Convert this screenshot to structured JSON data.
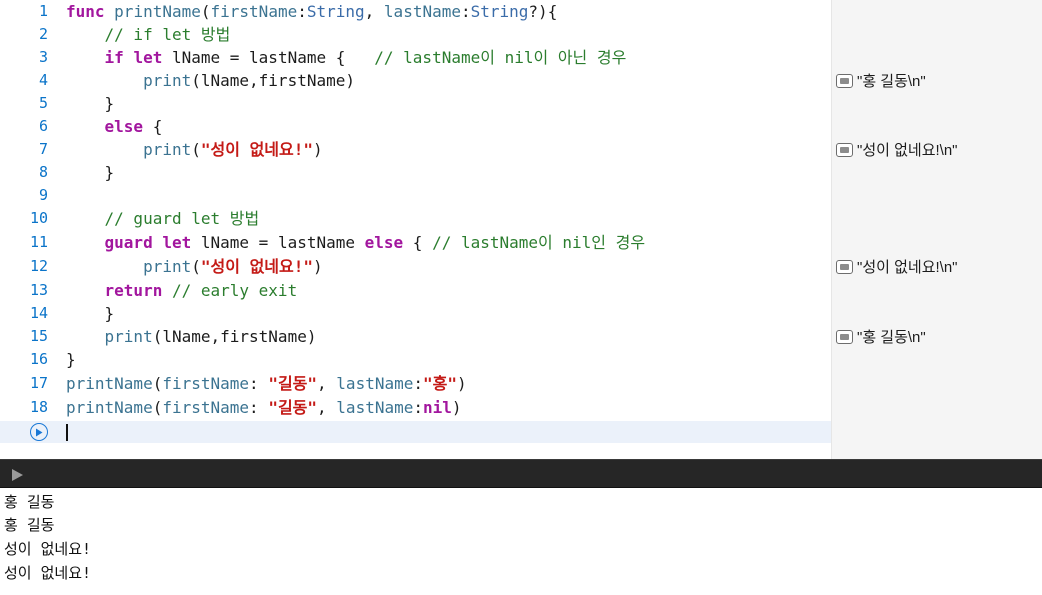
{
  "editor": {
    "lines": [
      {
        "n": "1"
      },
      {
        "n": "2"
      },
      {
        "n": "3"
      },
      {
        "n": "4"
      },
      {
        "n": "5"
      },
      {
        "n": "6"
      },
      {
        "n": "7"
      },
      {
        "n": "8"
      },
      {
        "n": "9"
      },
      {
        "n": "10"
      },
      {
        "n": "11"
      },
      {
        "n": "12"
      },
      {
        "n": "13"
      },
      {
        "n": "14"
      },
      {
        "n": "15"
      },
      {
        "n": "16"
      },
      {
        "n": "17"
      },
      {
        "n": "18"
      }
    ],
    "tokens": {
      "l1": [
        "func",
        "printName",
        "(",
        "firstName",
        ":",
        "String",
        ", ",
        "lastName",
        ":",
        "String",
        "?){"
      ],
      "l2": [
        "    // if let 방법"
      ],
      "l3": [
        "    ",
        "if",
        " ",
        "let",
        " lName = lastName {   ",
        "// lastName이 nil이 아닌 경우"
      ],
      "l4": [
        "        ",
        "print",
        "(lName,firstName)"
      ],
      "l5": [
        "    }"
      ],
      "l6": [
        "    ",
        "else",
        " {"
      ],
      "l7": [
        "        ",
        "print",
        "(",
        "\"성이 없네요!\"",
        ")"
      ],
      "l8": [
        "    }"
      ],
      "l9": [
        ""
      ],
      "l10": [
        "    // guard let 방법"
      ],
      "l11": [
        "    ",
        "guard",
        " ",
        "let",
        " lName = lastName ",
        "else",
        " { ",
        "// lastName이 nil인 경우"
      ],
      "l12": [
        "        ",
        "print",
        "(",
        "\"성이 없네요!\"",
        ")"
      ],
      "l13": [
        "    ",
        "return",
        " ",
        "// early exit"
      ],
      "l14": [
        "    }"
      ],
      "l15": [
        "    ",
        "print",
        "(lName,firstName)"
      ],
      "l16": [
        "}"
      ],
      "l17": [
        "printName",
        "(",
        "firstName",
        ": ",
        "\"길동\"",
        ", ",
        "lastName",
        ":",
        "\"홍\"",
        ")"
      ],
      "l18": [
        "printName",
        "(",
        "firstName",
        ": ",
        "\"길동\"",
        ", ",
        "lastName",
        ":",
        "nil",
        ")"
      ]
    }
  },
  "results": [
    {
      "text": "\"홍 길동\\n\""
    },
    {
      "text": "\"성이 없네요!\\n\""
    },
    {
      "text": "\"성이 없네요!\\n\""
    },
    {
      "text": "\"홍 길동\\n\""
    }
  ],
  "console": {
    "output": [
      "홍 길동",
      "홍 길동",
      "성이 없네요!",
      "성이 없네요!"
    ]
  },
  "icons": {
    "run": "play-circle-icon",
    "toggle": "play-triangle-icon",
    "result": "quick-look-icon"
  },
  "colors": {
    "keyword": "#a2169e",
    "type": "#3b6ca9",
    "comment": "#2b7d2e",
    "string": "#c41a16",
    "line_number": "#0b74c9",
    "run_button": "#1a78d6"
  }
}
